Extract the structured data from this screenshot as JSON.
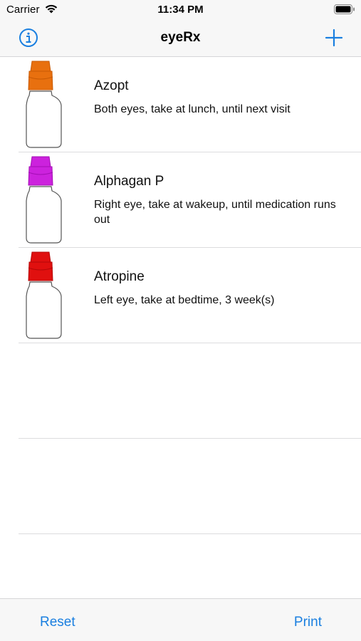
{
  "status_bar": {
    "carrier": "Carrier",
    "time": "11:34 PM",
    "wifi_icon": "wifi-icon",
    "battery_icon": "battery-icon"
  },
  "navbar": {
    "title": "eyeRx",
    "left_icon": "info-icon",
    "right_icon": "plus-icon",
    "accent": "#1a7fe0"
  },
  "medications": [
    {
      "name": "Azopt",
      "detail": "Both eyes, take at lunch, until next visit",
      "cap_color": "#e8700f",
      "cap_dark": "#c85a05"
    },
    {
      "name": "Alphagan P",
      "detail": "Right eye, take at wakeup, until medication runs out",
      "cap_color": "#cc22dd",
      "cap_dark": "#a40fb5"
    },
    {
      "name": "Atropine",
      "detail": "Left eye, take at bedtime, 3 week(s)",
      "cap_color": "#e0100f",
      "cap_dark": "#b50808"
    }
  ],
  "toolbar": {
    "reset_label": "Reset",
    "print_label": "Print"
  }
}
